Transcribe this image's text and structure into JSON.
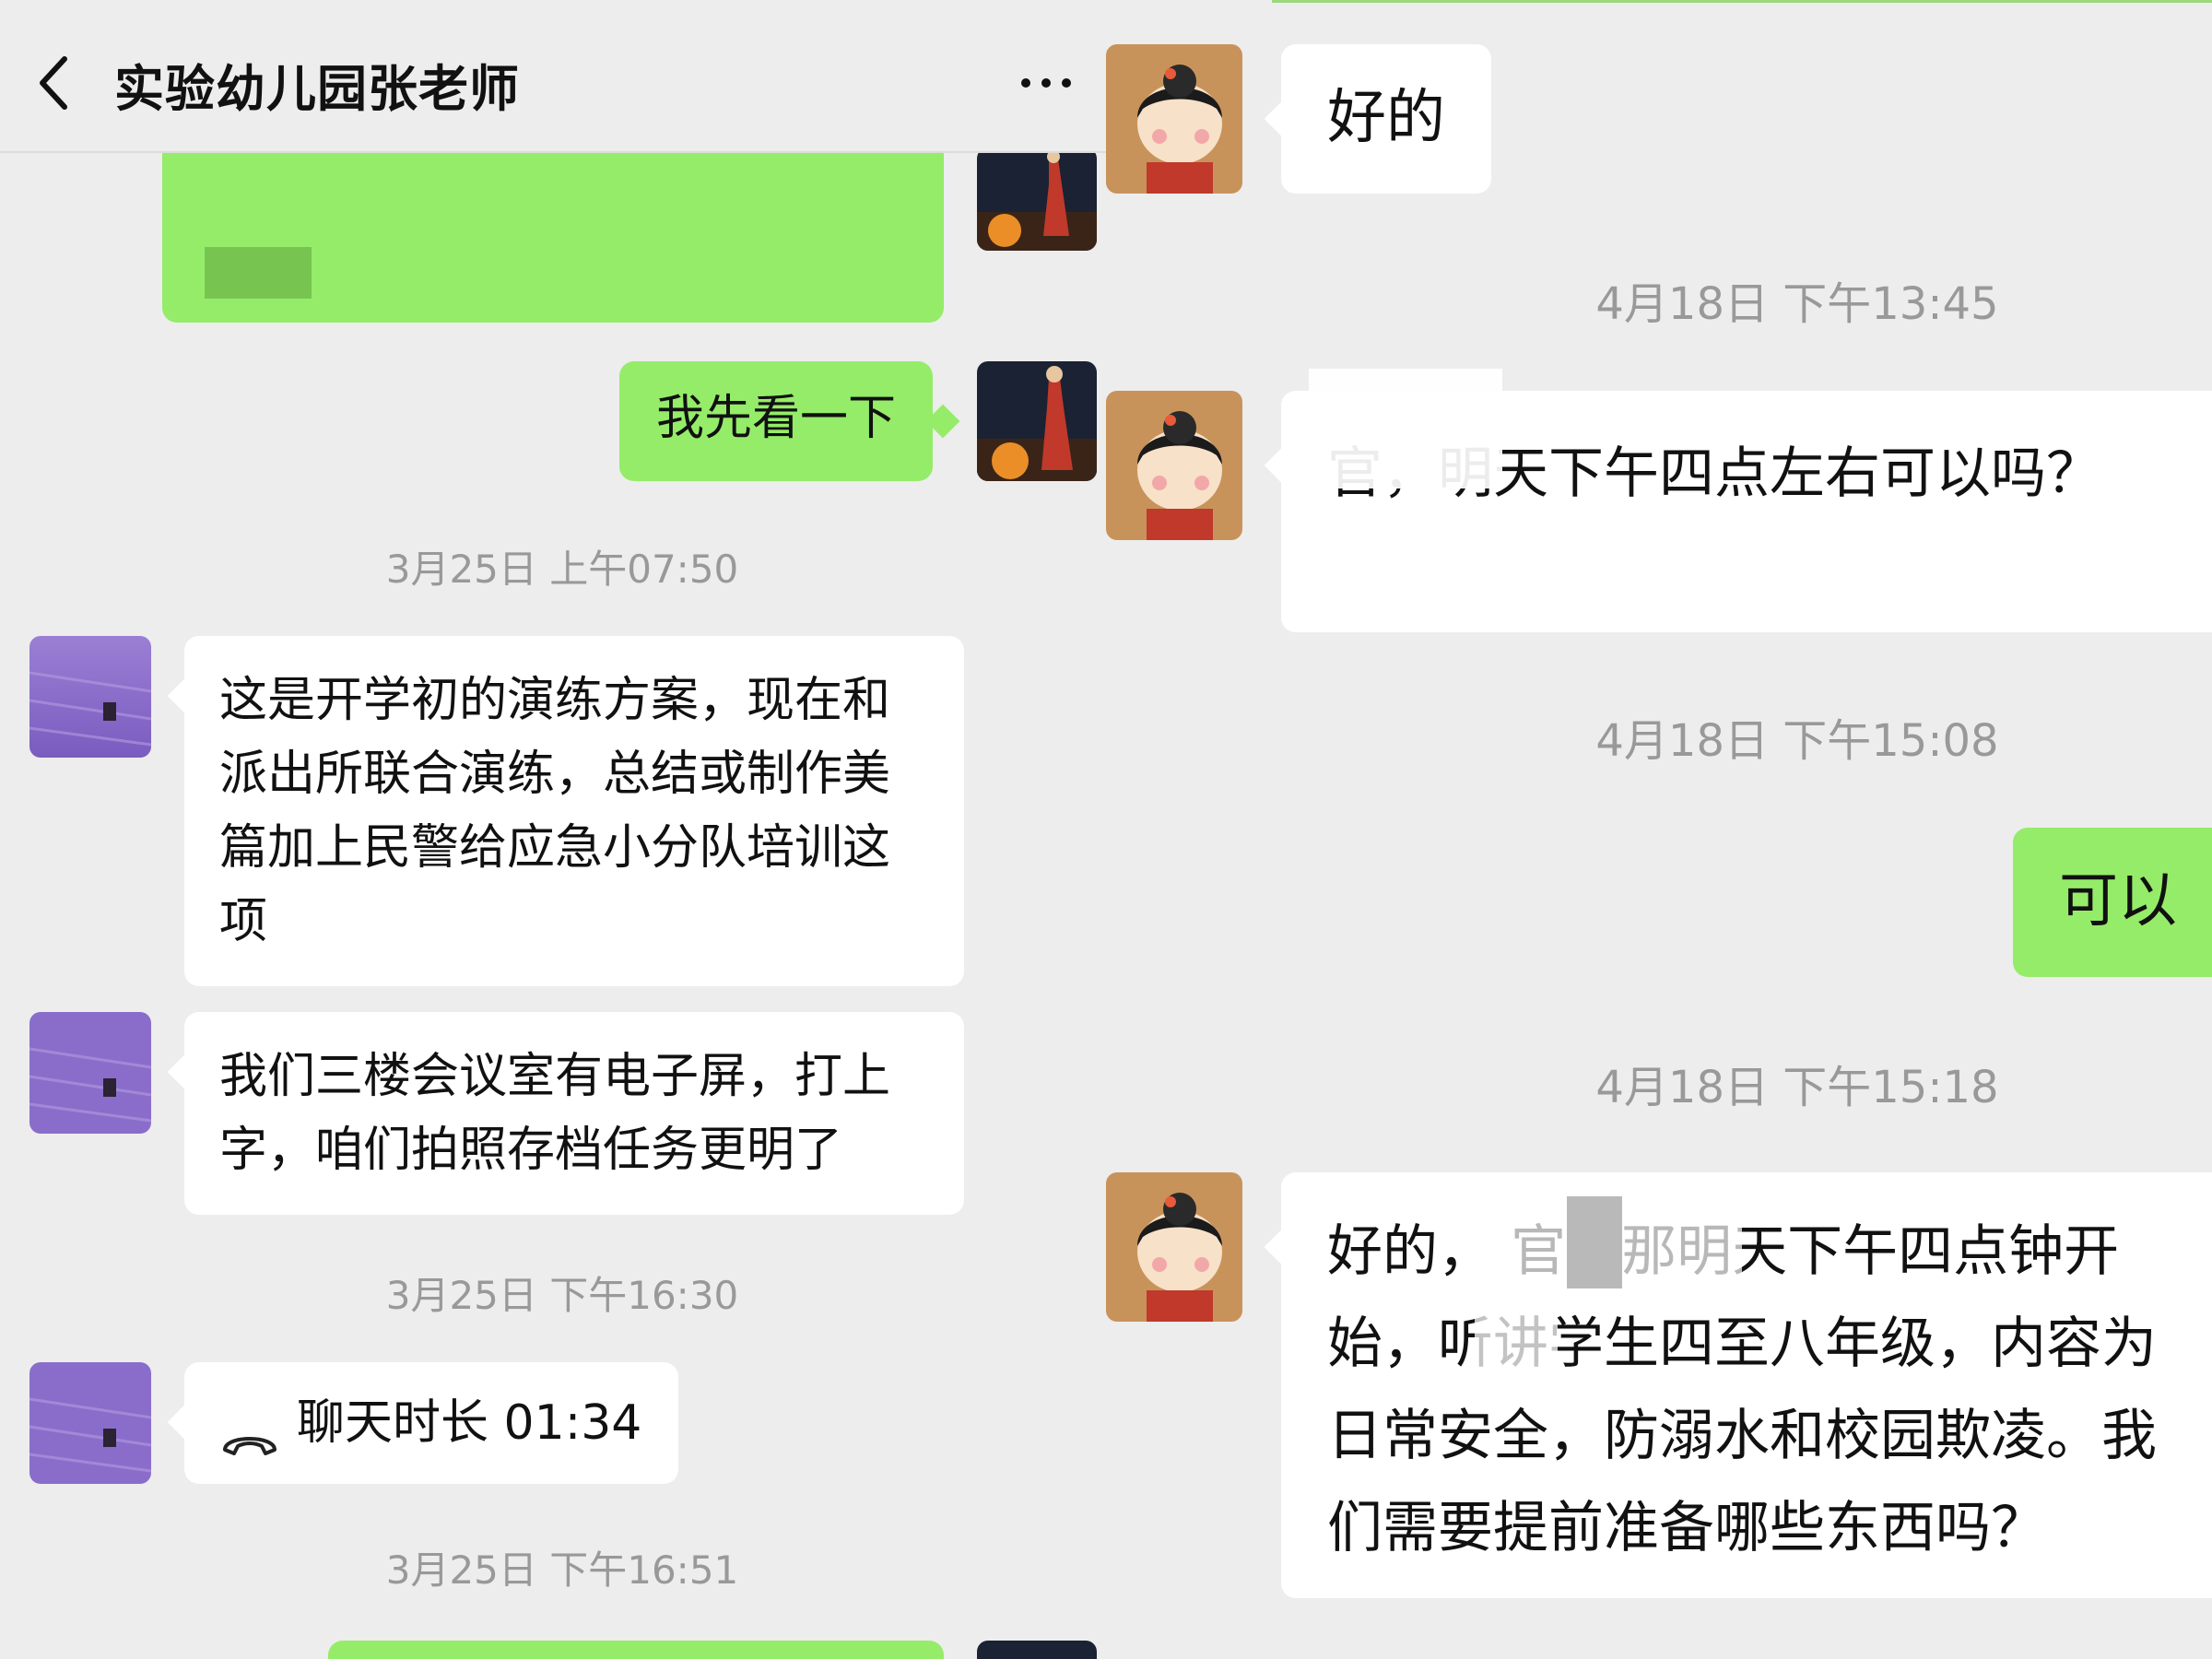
{
  "header": {
    "title": "实验幼儿园张老师"
  },
  "left": {
    "messages": [
      {
        "text": "我先看一下"
      },
      {
        "text": "这是开学初的演练方案，现在和派出所联合演练，总结或制作美篇加上民警给应急小分队培训这项"
      },
      {
        "text": "我们三楼会议室有电子屏，打上字，咱们拍照存档任务更明了"
      },
      {
        "text": "聊天时长 01:34"
      }
    ],
    "timestamps": [
      "3月25日 上午07:50",
      "3月25日 下午16:30",
      "3月25日 下午16:51"
    ]
  },
  "right": {
    "messages": [
      {
        "text": "好的"
      },
      {
        "text": "官，明天下午四点左右可以吗？"
      },
      {
        "text": "可以"
      },
      {
        "text": "好的，    官，那明天下午四点钟开始，听讲学生四至八年级，内容为日常安全，防溺水和校园欺凌。我们需要提前准备哪些东西吗？"
      }
    ],
    "timestamps": [
      "4月18日 下午13:45",
      "4月18日 下午15:08",
      "4月18日 下午15:18"
    ]
  },
  "icons": [
    "back-arrow-icon",
    "more-icon",
    "phone-call-icon"
  ],
  "colors": {
    "background": "#ededed",
    "incoming": "#ffffff",
    "outgoing": "#95ec69",
    "timestamp": "#999999"
  }
}
